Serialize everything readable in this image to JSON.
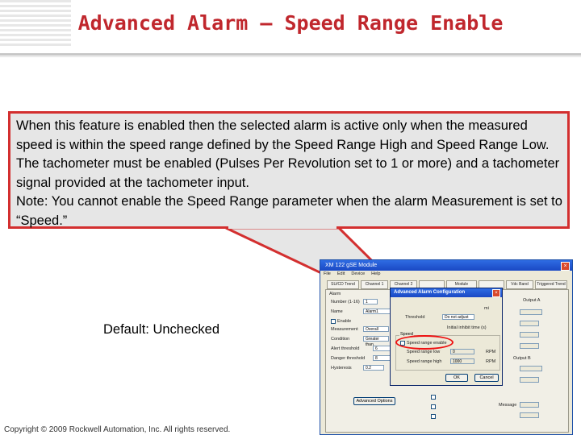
{
  "slide": {
    "title": "Advanced Alarm – Speed Range Enable",
    "description": "When this feature is enabled then the selected alarm is active only when the measured speed is within the speed range defined by the Speed Range High and Speed Range Low.  The tachometer must be enabled (Pulses Per Revolution set to 1 or more) and a tachometer signal  provided at the tachometer input.",
    "note": "Note: You cannot enable the Speed Range parameter when the alarm Measurement is set to “Speed.”",
    "default_label": "Default:  Unchecked",
    "copyright": "Copyright © 2009 Rockwell Automation, Inc. All rights reserved."
  },
  "colors": {
    "accent": "#c0272d",
    "callout_border": "#d32f2f",
    "callout_bg": "#e6e6e6"
  },
  "window": {
    "title": "XM 122 gSE Module",
    "menu": [
      "File",
      "Edit",
      "Device",
      "Help"
    ],
    "tabs": [
      "SU/CD Trend",
      "Channel 1",
      "Channel 2",
      "",
      "Module",
      "",
      "Vdc Band",
      "Triggered Trend"
    ],
    "alarm_group_label": "Alarm",
    "fields": {
      "number_label": "Number (1-16)",
      "number_value": "1",
      "name_label": "Name",
      "name_value": "Alarm1",
      "enable_label": "Enable",
      "measurement_label": "Measurement",
      "measurement_value": "Overall",
      "condition_label": "Condition",
      "condition_value": "Greater than",
      "alert_threshold_label": "Alert threshold",
      "alert_threshold_value": "6",
      "danger_threshold_label": "Danger threshold",
      "danger_threshold_value": "8",
      "hysteresis_label": "Hysteresis",
      "hysteresis_value": "0.2"
    },
    "advanced_button": "Advanced Options",
    "right_labels": {
      "output_a": "Output A",
      "output_b": "Output B",
      "relay_label": "Relay",
      "message_label": "Message"
    }
  },
  "dialog": {
    "title": "Advanced Alarm Configuration",
    "threshold_label": "Threshold",
    "threshold_value": "Do not adjust",
    "multiplier_suffix": "mi",
    "startup_label": "Initial inhibit time (s)",
    "startup_value": "0",
    "speed_group_label": "Speed",
    "speed_checkbox_label": "Speed range enable",
    "range_low_label": "Speed range low",
    "range_low_value": "0",
    "range_low_unit": "RPM",
    "range_high_label": "Speed range high",
    "range_high_value": "1000",
    "range_high_unit": "RPM",
    "ok_button": "OK",
    "cancel_button": "Cancel"
  }
}
